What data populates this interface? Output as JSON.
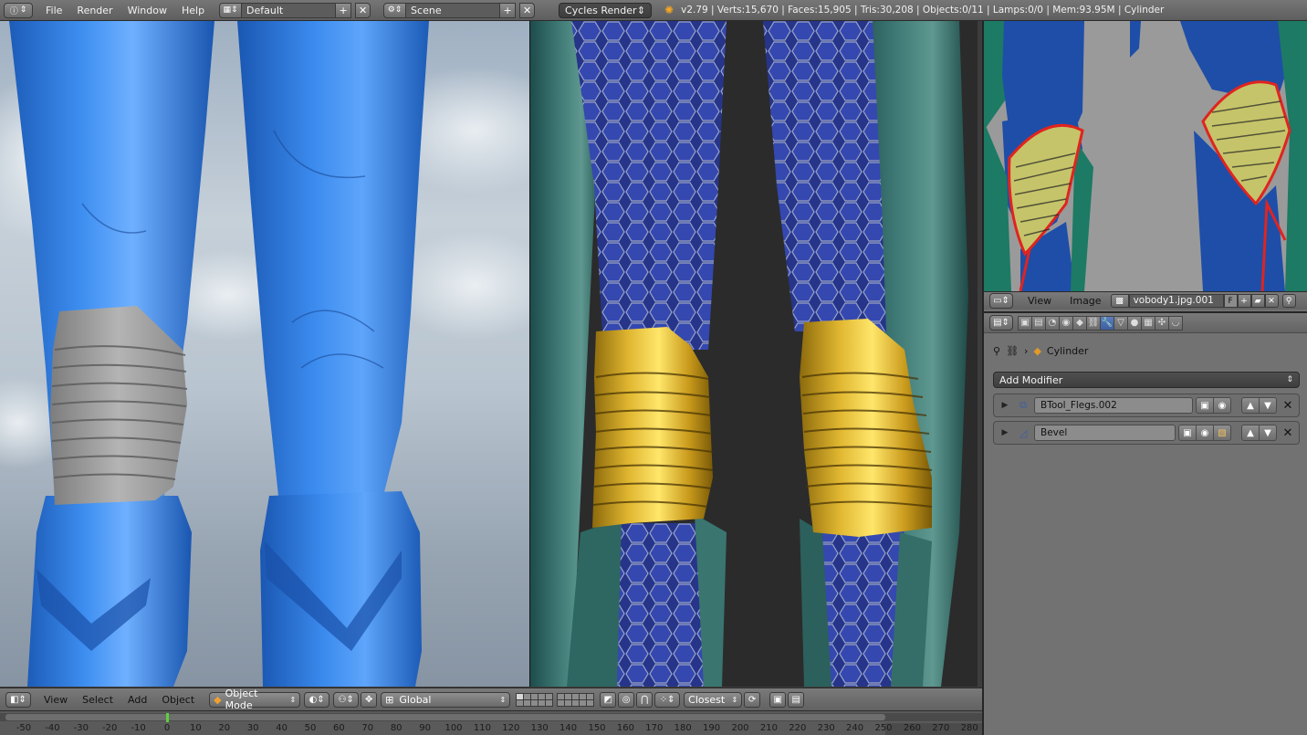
{
  "top_header": {
    "editor_icon": "info-icon",
    "menu": [
      "File",
      "Render",
      "Window",
      "Help"
    ],
    "screen_layout": "Default",
    "scene": "Scene",
    "render_engine": "Cycles Render",
    "stats": "v2.79 | Verts:15,670 | Faces:15,905 | Tris:30,208 | Objects:0/11 | Lamps:0/0 | Mem:93.95M | Cylinder"
  },
  "view3d_header": {
    "menu": [
      "View",
      "Select",
      "Add",
      "Object"
    ],
    "mode": "Object Mode",
    "orientation": "Global",
    "snap_target": "Closest"
  },
  "timeline": {
    "ticks": [
      "-50",
      "-40",
      "-30",
      "-20",
      "-10",
      "0",
      "10",
      "20",
      "30",
      "40",
      "50",
      "60",
      "70",
      "80",
      "90",
      "100",
      "110",
      "120",
      "130",
      "140",
      "150",
      "160",
      "170",
      "180",
      "190",
      "200",
      "210",
      "220",
      "230",
      "240",
      "250",
      "260",
      "270",
      "280"
    ],
    "current_frame_marker": "1"
  },
  "image_editor": {
    "menu": [
      "View",
      "Image"
    ],
    "image_name": "vobody1.jpg.001",
    "fake_user": "F"
  },
  "properties": {
    "breadcrumb_object": "Cylinder",
    "add_modifier_label": "Add Modifier",
    "modifiers": [
      {
        "name": "BTool_Flegs.002",
        "icon": "boolean-icon"
      },
      {
        "name": "Bevel",
        "icon": "bevel-icon"
      }
    ]
  },
  "colors": {
    "suit_blue": "#2f78d8",
    "gold": "#d4a82a",
    "accent": "#5a7dbe"
  }
}
